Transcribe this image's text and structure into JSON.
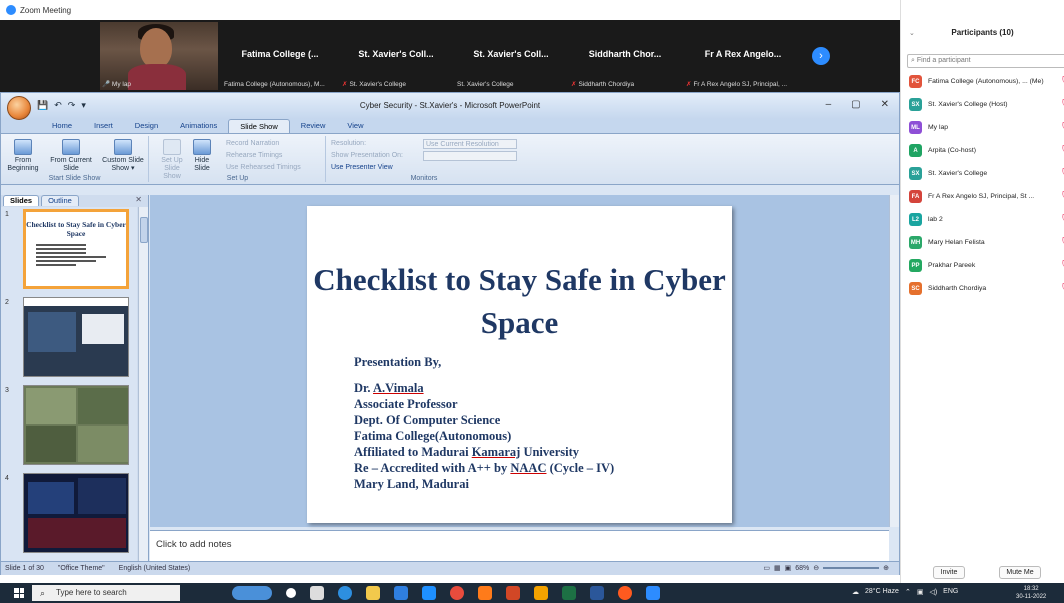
{
  "zoom": {
    "window_title": "Zoom Meeting",
    "win_minimize": "–",
    "win_maximize": "▢",
    "win_close": "✕",
    "self_label": "My lap",
    "tiles": [
      {
        "name": "Fatima College (...",
        "sub": "Fatima College (Autonomous), M...",
        "muted": false
      },
      {
        "name": "St. Xavier's Coll...",
        "sub": "St. Xavier's College",
        "muted": true
      },
      {
        "name": "St. Xavier's Coll...",
        "sub": "St. Xavier's College",
        "muted": false
      },
      {
        "name": "Siddharth Chor...",
        "sub": "Siddharth Chordiya",
        "muted": true
      },
      {
        "name": "Fr A Rex Angelo...",
        "sub": "Fr A Rex Angelo SJ, Principal, ...",
        "muted": true
      }
    ],
    "next_glyph": "›"
  },
  "ppt": {
    "caption": "Cyber Security - St.Xavier's - Microsoft PowerPoint",
    "tabs": [
      "Home",
      "Insert",
      "Design",
      "Animations",
      "Slide Show",
      "Review",
      "View"
    ],
    "active_tab": "Slide Show",
    "ribbon": {
      "start_group": "Start Slide Show",
      "setup_group": "Set Up",
      "monitors_group": "Monitors",
      "from_beginning": "From Beginning",
      "from_current": "From Current Slide",
      "custom": "Custom Slide Show ▾",
      "setup_show": "Set Up Slide Show",
      "hide_slide": "Hide Slide",
      "record_narration": "Record Narration",
      "rehearse": "Rehearse Timings",
      "use_rehearsed": "Use Rehearsed Timings",
      "resolution_label": "Resolution:",
      "resolution_value": "Use Current Resolution",
      "show_on_label": "Show Presentation On:",
      "presenter_view": "Use Presenter View"
    },
    "pane_tabs": [
      "Slides",
      "Outline"
    ],
    "thumb_numbers": [
      "1",
      "2",
      "3",
      "4"
    ],
    "slide": {
      "title": "Checklist to Stay Safe in Cyber Space",
      "presented_by": "Presentation By,",
      "name_prefix": "Dr. ",
      "name_underlined": "A.Vimala",
      "lines": [
        "Associate Professor",
        "Dept. Of Computer Science",
        "Fatima College(Autonomous)"
      ],
      "affiliated_prefix": "Affiliated to Madurai ",
      "affiliated_underlined": "Kamaraj",
      "affiliated_suffix": " University",
      "reaccredited_prefix": "Re – Accredited with A++ by ",
      "reaccredited_underlined": "NAAC",
      "reaccredited_suffix": " (Cycle – IV)",
      "last_line": "Mary Land,  Madurai"
    },
    "notes_placeholder": "Click to add notes",
    "status": {
      "slide_of": "Slide 1 of 30",
      "theme": "\"Office Theme\"",
      "language": "English (United States)",
      "zoom": "68%"
    }
  },
  "participants": {
    "header": "Participants (10)",
    "search_placeholder": "Find a participant",
    "list": [
      {
        "initials": "FC",
        "color": "#e2543c",
        "name": "Fatima College (Autonomous), ...  (Me)"
      },
      {
        "initials": "SX",
        "color": "#2aa198",
        "name": "St. Xavier's College (Host)"
      },
      {
        "initials": "ML",
        "color": "#8e4fd6",
        "name": "My lap"
      },
      {
        "initials": "A",
        "color": "#1fa463",
        "name": "Arpita (Co-host)"
      },
      {
        "initials": "SX",
        "color": "#2aa198",
        "name": "St. Xavier's College"
      },
      {
        "initials": "FA",
        "color": "#d4443b",
        "name": "Fr A Rex Angelo SJ, Principal, St ..."
      },
      {
        "initials": "L2",
        "color": "#1aa5a0",
        "name": "lab 2"
      },
      {
        "initials": "MH",
        "color": "#2ba86a",
        "name": "Mary Helan Felista"
      },
      {
        "initials": "PP",
        "color": "#24a861",
        "name": "Prakhar Pareek"
      },
      {
        "initials": "SC",
        "color": "#e5702d",
        "name": "Siddharth Chordiya"
      }
    ],
    "invite": "Invite",
    "mute_me": "Mute Me"
  },
  "taskbar": {
    "search_placeholder": "Type here to search",
    "weather": "28°C  Haze",
    "lang": "ENG",
    "time": "18:32",
    "date": "30-11-2022"
  },
  "colors": {
    "zoom_blue": "#2d8cff",
    "slide_text": "#1f3864",
    "selected_thumb": "#f4a33a"
  }
}
